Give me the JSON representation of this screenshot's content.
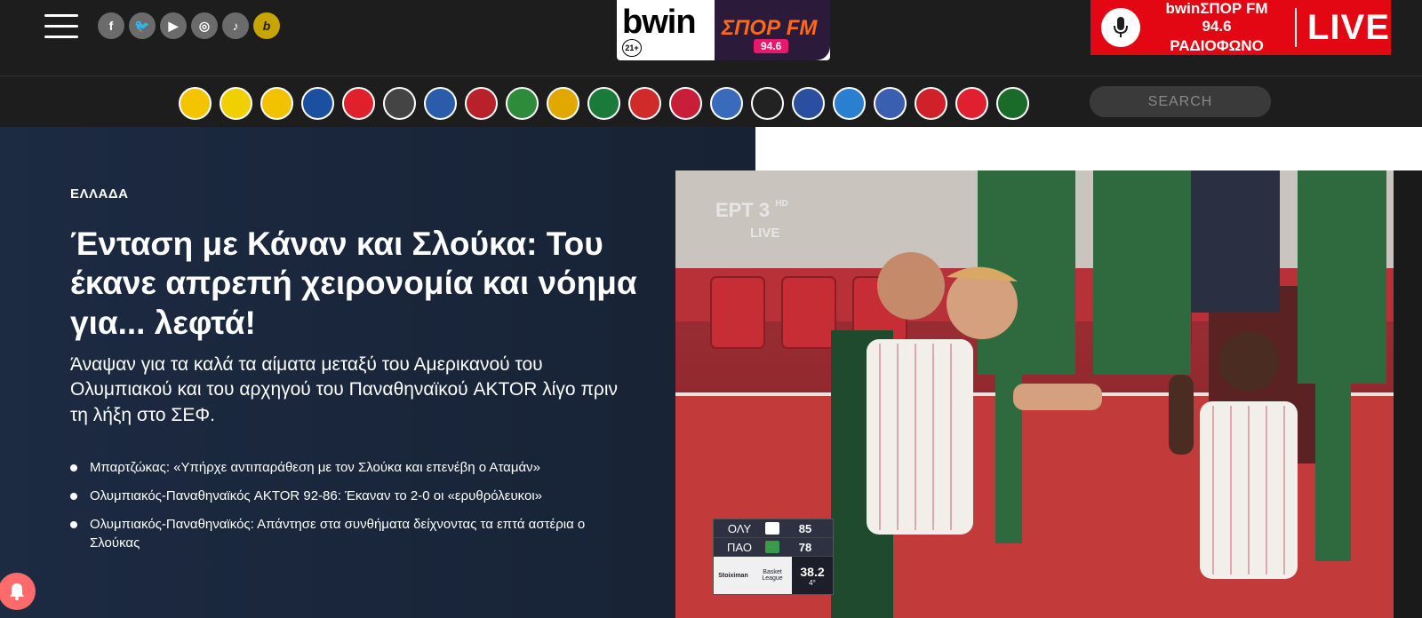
{
  "social": [
    {
      "name": "facebook-icon",
      "glyph": "f"
    },
    {
      "name": "twitter-icon",
      "glyph": "🐦"
    },
    {
      "name": "youtube-icon",
      "glyph": "▶"
    },
    {
      "name": "instagram-icon",
      "glyph": "◎"
    },
    {
      "name": "tiktok-icon",
      "glyph": "♪"
    },
    {
      "name": "bwin-icon",
      "glyph": "b"
    }
  ],
  "logo": {
    "brand": "bwin",
    "age": "21+",
    "station": "ΣΠΟΡ FM",
    "frequency": "94.6"
  },
  "live": {
    "line1": "bwinΣΠΟΡ FM 94.6",
    "line2": "ΡΑΔΙΟΦΩΝΟ",
    "label": "LIVE"
  },
  "teams": [
    {
      "name": "team-aek-icon",
      "color": "#f5c400"
    },
    {
      "name": "team-aris-icon",
      "color": "#f0d000"
    },
    {
      "name": "team-asteras-icon",
      "color": "#f2c200"
    },
    {
      "name": "team-atromitos-icon",
      "color": "#1b4fa0"
    },
    {
      "name": "team-olympiacos-icon",
      "color": "#e0202a"
    },
    {
      "name": "team-ofi-icon",
      "color": "#444444"
    },
    {
      "name": "team-kifisia-icon",
      "color": "#2a5caa"
    },
    {
      "name": "team-larissa-icon",
      "color": "#b8202a"
    },
    {
      "name": "team-levadiakos-icon",
      "color": "#2e8b3a"
    },
    {
      "name": "team-panaitolikos-icon",
      "color": "#e0a800"
    },
    {
      "name": "team-panathinaikos-icon",
      "color": "#1a7a3a"
    },
    {
      "name": "team-panserraikos-icon",
      "color": "#d02a2a"
    },
    {
      "name": "team-volos-icon",
      "color": "#c81e3a"
    },
    {
      "name": "team-iraklis-icon",
      "color": "#3a6abc"
    },
    {
      "name": "team-paok-icon",
      "color": "#222222"
    },
    {
      "name": "team-ionikos-icon",
      "color": "#2a4fa0"
    },
    {
      "name": "team-apollon-icon",
      "color": "#2a7fd0"
    },
    {
      "name": "team-lamia-icon",
      "color": "#3a5fb0"
    },
    {
      "name": "team-panionios-icon",
      "color": "#d0202a"
    },
    {
      "name": "team-olympiacos-bc-icon",
      "color": "#e02030"
    },
    {
      "name": "team-panathinaikos-bc-icon",
      "color": "#1a6a2a"
    }
  ],
  "search": {
    "placeholder": "SEARCH"
  },
  "article": {
    "category": "ΕΛΛΑΔΑ",
    "headline": "Ένταση με Κάναν και Σλούκα: Του έκανε απρεπή χειρονομία και νόημα για... λεφτά!",
    "summary": "Άναψαν για τα καλά τα αίματα μεταξύ του Αμερικανού του Ολυμπιακού και του αρχηγού του Παναθηναϊκού AKTOR λίγο πριν τη λήξη στο ΣΕΦ.",
    "related": [
      "Μπαρτζώκας: «Υπήρχε αντιπαράθεση με τον Σλούκα και επενέβη ο Αταμάν»",
      "Ολυμπιακός-Παναθηναϊκός AKTOR 92-86: Έκαναν το 2-0 οι «ερυθρόλευκοι»",
      "Ολυμπιακός-Παναθηναϊκός: Απάντησε στα συνθήματα δείχνοντας τα επτά αστέρια ο Σλούκας"
    ]
  },
  "photo": {
    "channel": "ΕΡΤ 3",
    "hd": "HD",
    "live": "LIVE",
    "team1": "ΟΛΥ",
    "score1": "85",
    "team2": "ΠΑΟ",
    "score2": "78",
    "sponsor": "Stoiximan",
    "league": "Basket League",
    "clock": "38.2",
    "period": "4°"
  },
  "colors": {
    "accent_red": "#e30613",
    "hero_bg": "#1c2a42",
    "topbar_bg": "#1d1d1d"
  }
}
